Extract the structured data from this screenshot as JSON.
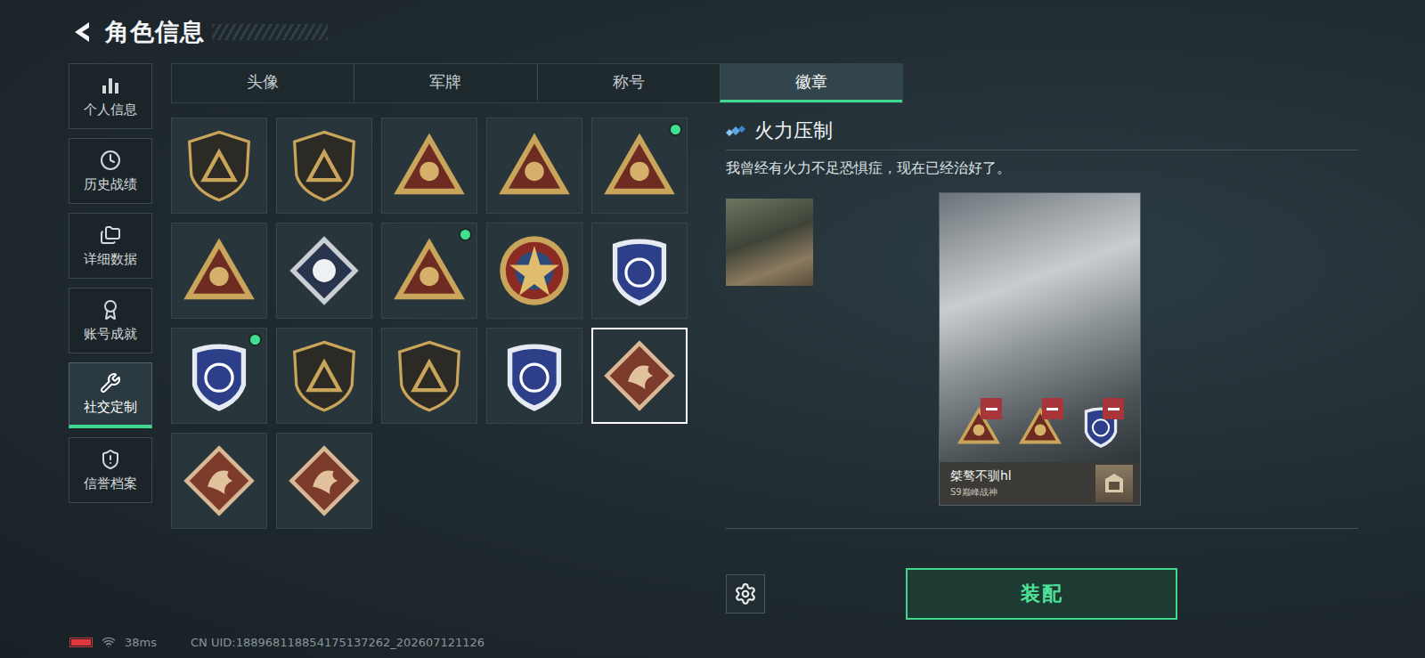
{
  "header": {
    "title": "角色信息"
  },
  "sidebar": {
    "items": [
      {
        "label": "个人信息",
        "selected": false
      },
      {
        "label": "历史战绩",
        "selected": false
      },
      {
        "label": "详细数据",
        "selected": false
      },
      {
        "label": "账号成就",
        "selected": false
      },
      {
        "label": "社交定制",
        "selected": true
      },
      {
        "label": "信誉档案",
        "selected": false
      }
    ]
  },
  "tabs": [
    {
      "label": "头像",
      "selected": false
    },
    {
      "label": "军牌",
      "selected": false
    },
    {
      "label": "称号",
      "selected": false
    },
    {
      "label": "徽章",
      "selected": true
    }
  ],
  "badges": [
    {
      "kind": "shield",
      "new": false,
      "selected": false
    },
    {
      "kind": "shield",
      "new": false,
      "selected": false
    },
    {
      "kind": "triangle",
      "new": false,
      "selected": false
    },
    {
      "kind": "triangle",
      "new": false,
      "selected": false
    },
    {
      "kind": "triangle",
      "new": true,
      "selected": false
    },
    {
      "kind": "triangle",
      "new": false,
      "selected": false
    },
    {
      "kind": "silver-diamond",
      "new": false,
      "selected": false
    },
    {
      "kind": "triangle",
      "new": true,
      "selected": false
    },
    {
      "kind": "round",
      "new": false,
      "selected": false
    },
    {
      "kind": "blue-shield",
      "new": false,
      "selected": false
    },
    {
      "kind": "blue-shield",
      "new": true,
      "selected": false
    },
    {
      "kind": "shield",
      "new": false,
      "selected": false
    },
    {
      "kind": "shield",
      "new": false,
      "selected": false
    },
    {
      "kind": "blue-shield",
      "new": false,
      "selected": false
    },
    {
      "kind": "red-diamond",
      "new": false,
      "selected": true
    },
    {
      "kind": "red-diamond",
      "new": false,
      "selected": false
    },
    {
      "kind": "red-diamond",
      "new": false,
      "selected": false
    }
  ],
  "detail": {
    "title": "火力压制",
    "description": "我曾经有火力不足恐惧症，现在已经治好了。",
    "card": {
      "name": "桀骜不驯hl",
      "subtitle": "S9巅峰战神",
      "equipped": [
        {
          "kind": "triangle"
        },
        {
          "kind": "triangle"
        },
        {
          "kind": "blue-shield"
        }
      ]
    }
  },
  "equip_button": "装配",
  "status_bar": {
    "battery_level": 1,
    "ping": "38ms",
    "uid": "CN UID:188968118854175137262_202607121126"
  }
}
